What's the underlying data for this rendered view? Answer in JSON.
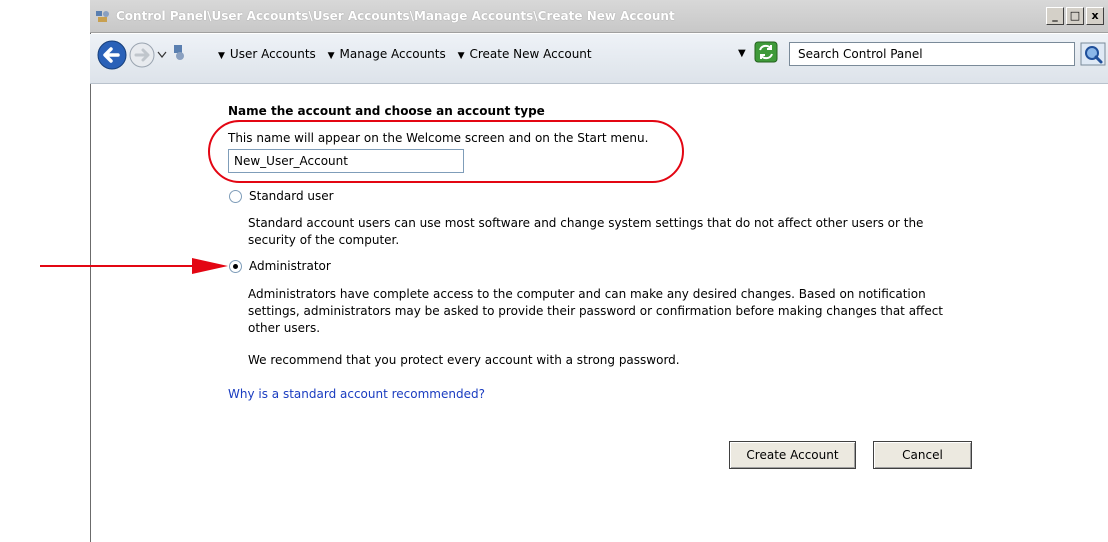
{
  "window": {
    "title": "Control Panel\\User Accounts\\User Accounts\\Manage Accounts\\Create New Account",
    "controls": {
      "minimize": "_",
      "maximize": "□",
      "close": "x"
    }
  },
  "addressbar": {
    "breadcrumbs": [
      "User Accounts",
      "Manage Accounts",
      "Create New Account"
    ],
    "search_placeholder": "Search Control Panel"
  },
  "main": {
    "heading": "Name the account and choose an account type",
    "name_description": "This name will appear on the Welcome screen and on the Start menu.",
    "account_name_value": "New_User_Account",
    "standard_user": {
      "label": "Standard user",
      "selected": false,
      "description": "Standard account users can use most software and change system settings that do not affect other users or the security of the computer."
    },
    "administrator": {
      "label": "Administrator",
      "selected": true,
      "description": "Administrators have complete access to the computer and can make any desired changes. Based on notification settings, administrators may be asked to provide their password or confirmation before making changes that affect other users."
    },
    "recommendation": "We recommend that you protect every account with a strong password.",
    "help_link": "Why is a standard account recommended?",
    "buttons": {
      "create": "Create Account",
      "cancel": "Cancel"
    }
  },
  "colors": {
    "annotation_red": "#e30613",
    "link_blue": "#1a3cc0"
  }
}
